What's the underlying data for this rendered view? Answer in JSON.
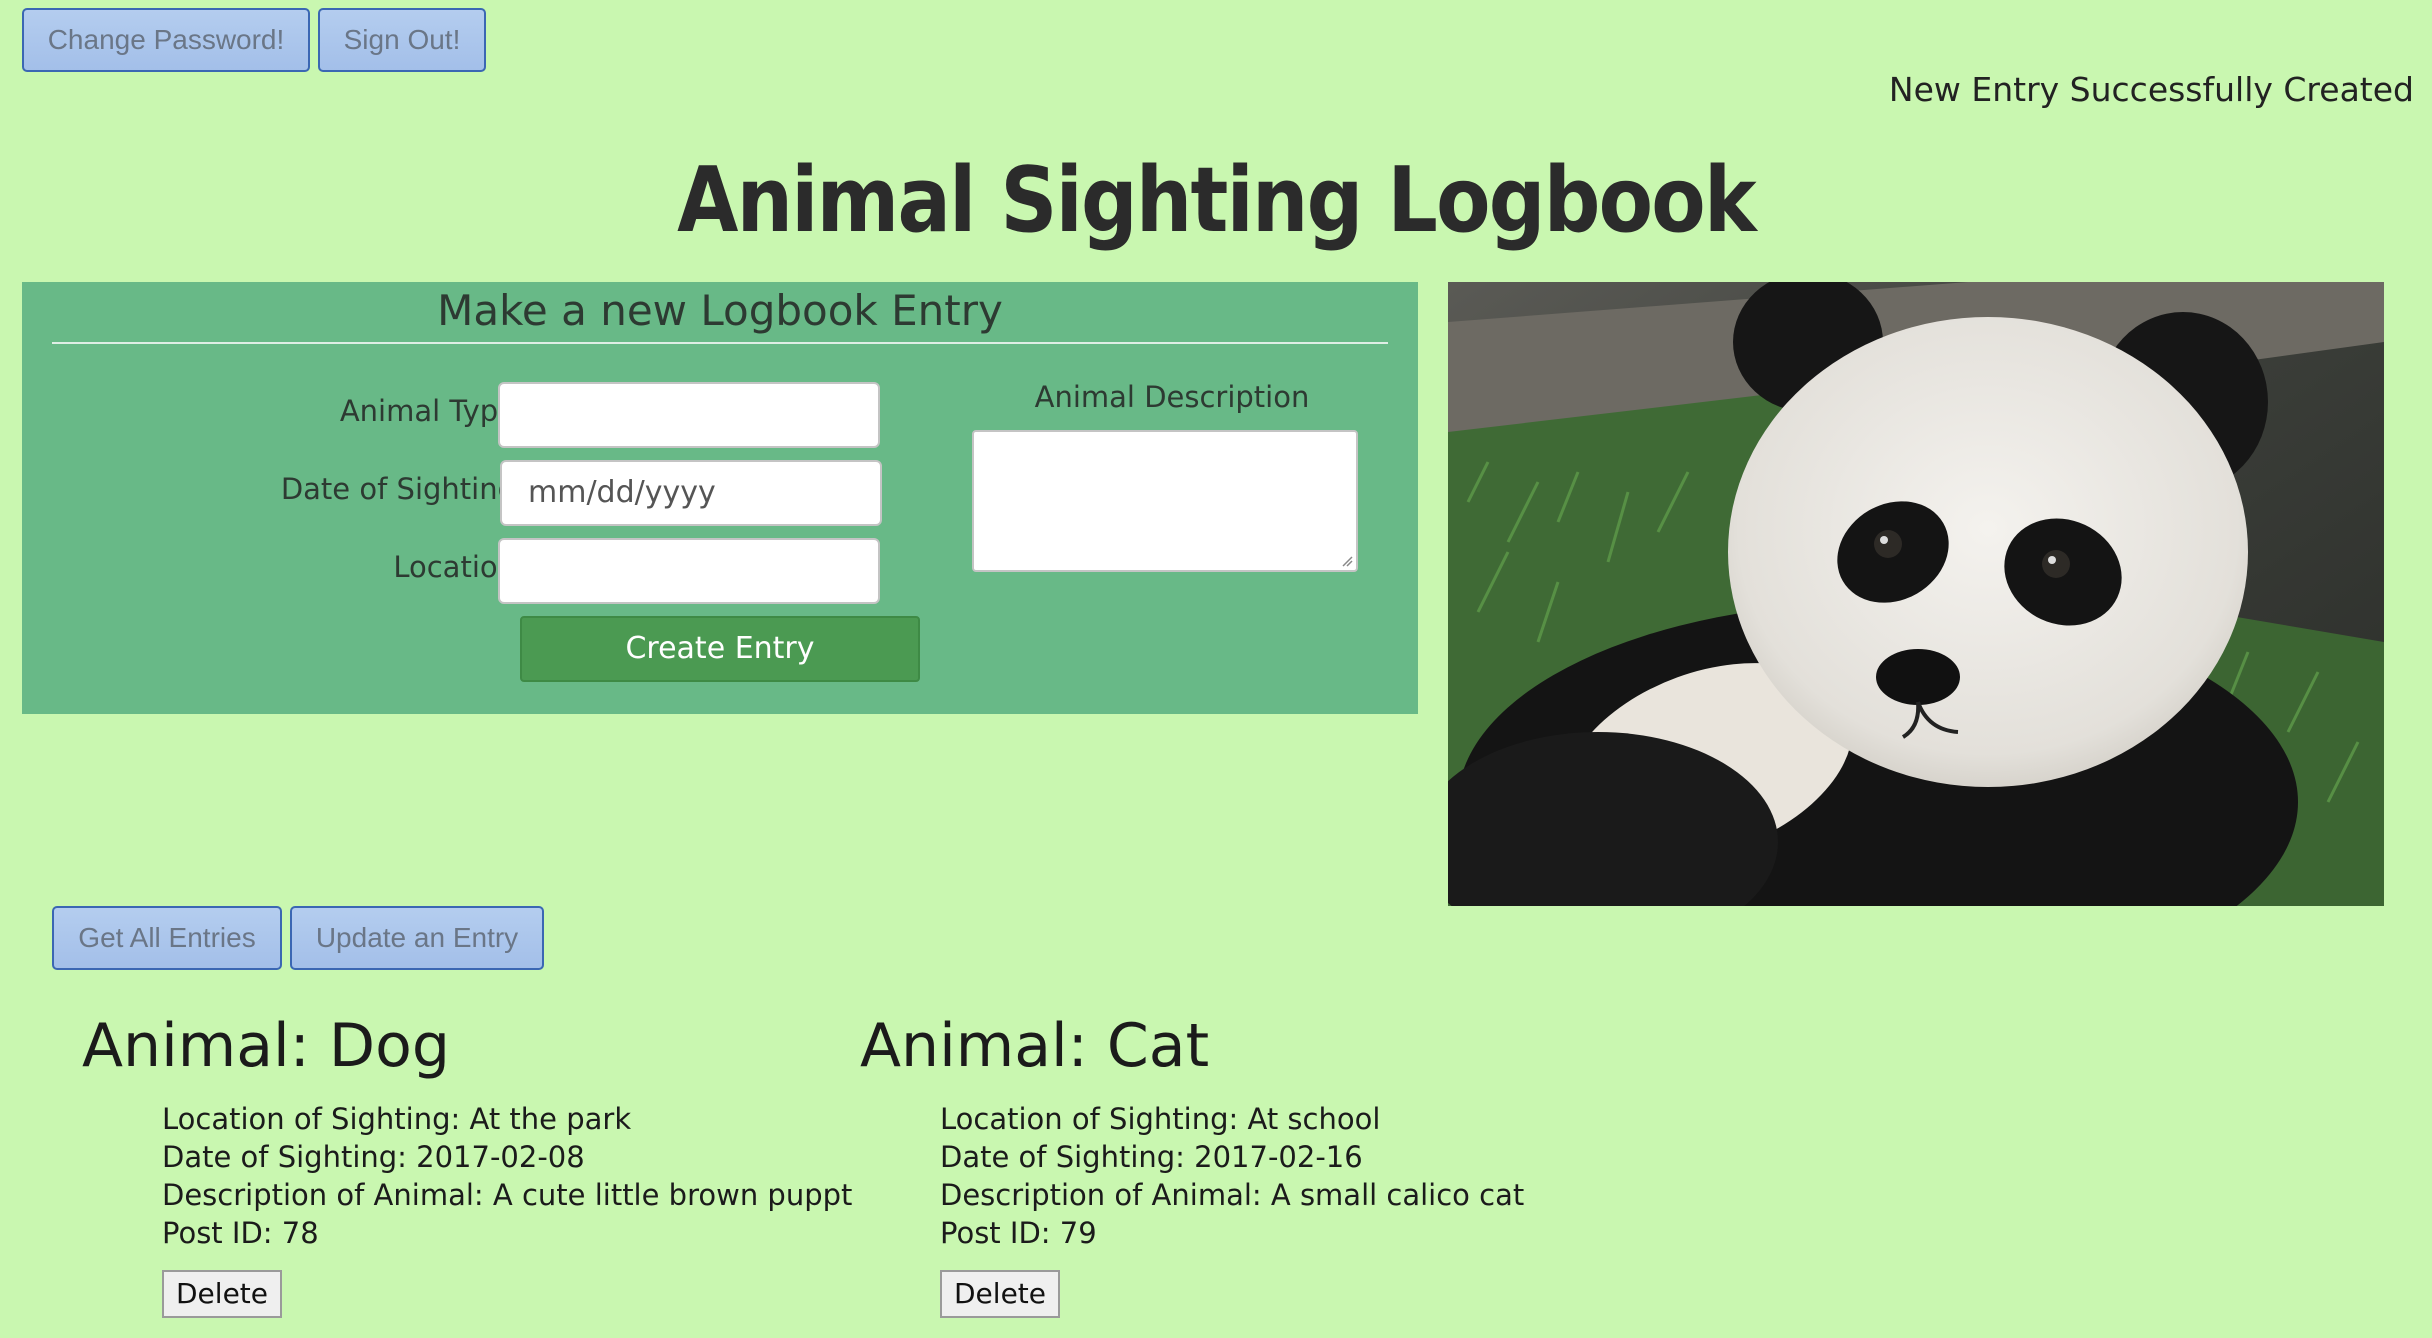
{
  "topbar": {
    "change_password_label": "Change Password!",
    "sign_out_label": "Sign Out!"
  },
  "status_message": "New Entry Successfully Created",
  "page_title": "Animal Sighting Logbook",
  "form": {
    "heading": "Make a new Logbook Entry",
    "animal_type_label": "Animal Type",
    "animal_type_value": "",
    "date_label": "Date of Sighting",
    "date_placeholder": "mm/dd/yyyy",
    "location_label": "Location",
    "location_value": "",
    "description_label": "Animal Description",
    "description_value": "",
    "create_button_label": "Create Entry"
  },
  "image": {
    "subject": "giant panda cub on grass"
  },
  "actions": {
    "get_all_label": "Get All Entries",
    "update_label": "Update an Entry"
  },
  "entries": [
    {
      "title": "Animal: Dog",
      "location": "Location of Sighting: At the park",
      "date": "Date of Sighting: 2017-02-08",
      "description": "Description of Animal: A cute little brown puppt",
      "post_id": "Post ID: 78",
      "delete_label": "Delete"
    },
    {
      "title": "Animal: Cat",
      "location": "Location of Sighting: At school",
      "date": "Date of Sighting: 2017-02-16",
      "description": "Description of Animal: A small calico cat",
      "post_id": "Post ID: 79",
      "delete_label": "Delete"
    }
  ],
  "colors": {
    "page_background": "#c9f7b0",
    "form_panel": "#68b987",
    "create_button": "#4b9a52",
    "blue_button": "#a9c5ec"
  }
}
